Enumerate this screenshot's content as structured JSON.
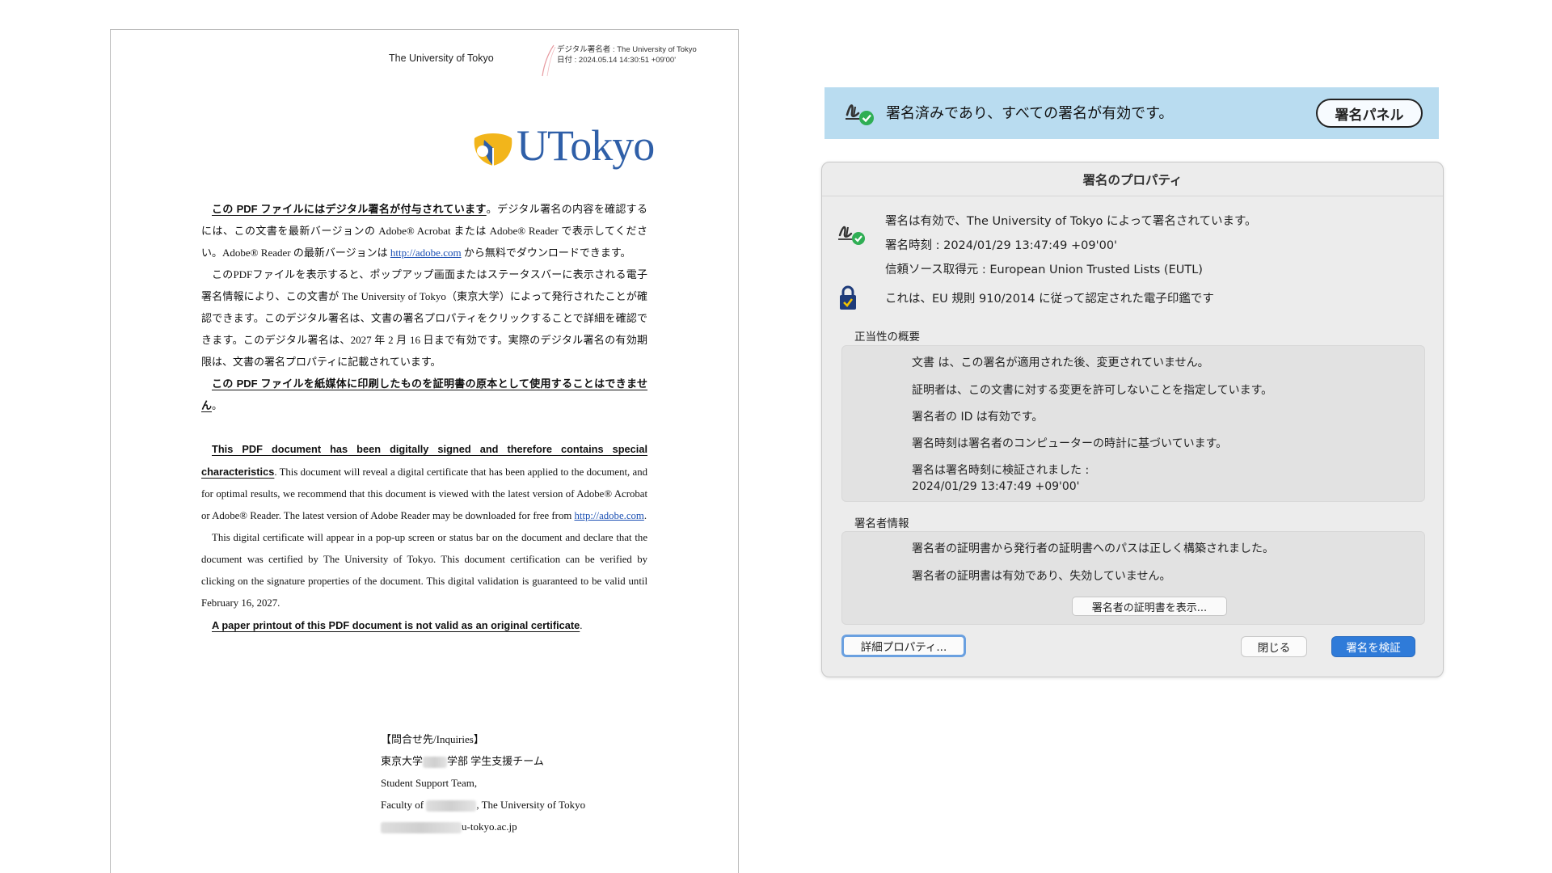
{
  "pdf": {
    "header_university": "The University of Tokyo",
    "stamp_line1": "デジタル署名者 : The University of Tokyo",
    "stamp_line2": "日付 : 2024.05.14 14:30:51 +09'00'",
    "logo_text": "UTokyo",
    "jp_p1_bold": "この PDF ファイルにはデジタル署名が付与されています",
    "jp_p1_rest_a": "。デジタル署名の内容を確認するには、この文書を最新バージョンの Adobe® Acrobat または Adobe® Reader で表示してください。Adobe® Reader の最新バージョンは ",
    "jp_p1_link": "http://adobe.com",
    "jp_p1_rest_b": " から無料でダウンロードできます。",
    "jp_p2": "このPDFファイルを表示すると、ポップアップ画面またはステータスバーに表示される電子署名情報により、この文書が The University of Tokyo（東京大学）によって発行されたことが確認できます。このデジタル署名は、文書の署名プロパティをクリックすることで詳細を確認できます。このデジタル署名は、2027 年 2 月 16 日まで有効です。実際のデジタル署名の有効期限は、文書の署名プロパティに記載されています。",
    "jp_p3_bold": "この PDF ファイルを紙媒体に印刷したものを証明書の原本として使用することはできません",
    "jp_p3_end": "。",
    "en_p1_bold": "This PDF document has been digitally signed and therefore contains special characteristics",
    "en_p1_rest_a": ". This document will reveal a digital certificate that has been applied to the document, and for optimal results, we recommend that this document is viewed with the latest version of Adobe® Acrobat or Adobe® Reader. The latest version of Adobe Reader may be downloaded for free from ",
    "en_p1_link": "http://adobe.com",
    "en_p1_rest_b": ".",
    "en_p2": "This digital certificate will appear in a pop-up screen or status bar on the document and declare that the document was certified by The University of Tokyo. This document certification can be verified by clicking on the signature properties of the document. This digital validation is guaranteed to be valid until February 16, 2027.",
    "en_p3_bold": "A paper printout of this PDF document is not valid as an original certificate",
    "en_p3_end": ".",
    "inquiry_title": "【問合せ先/Inquiries】",
    "inquiry_line1_a": "東京大学",
    "inquiry_line1_b": "学部 学生支援チーム",
    "inquiry_line2": "Student Support Team,",
    "inquiry_line3_a": "Faculty of",
    "inquiry_line3_b": ", The University of Tokyo",
    "inquiry_line4": "u-tokyo.ac.jp"
  },
  "banner": {
    "text": "署名済みであり、すべての署名が有効です。",
    "panel_button": "署名パネル",
    "bg_color": "#b9dcf0"
  },
  "dialog": {
    "title": "署名のプロパティ",
    "info_line1": "署名は有効で、The University of Tokyo によって署名されています。",
    "info_line2": "署名時刻 :  2024/01/29 13:47:49 +09'00'",
    "info_line3": "信頼ソース取得元 : European Union Trusted Lists (EUTL)",
    "eu_line": "これは、EU 規則 910/2014 に従って認定された電子印鑑です",
    "validity_label": "正当性の概要",
    "validity_items": [
      "文書 は、この署名が適用された後、変更されていません。",
      "証明者は、この文書に対する変更を許可しないことを指定しています。",
      "署名者の ID は有効です。",
      "署名時刻は署名者のコンピューターの時計に基づいています。",
      "署名は署名時刻に検証されました :",
      "2024/01/29 13:47:49 +09'00'"
    ],
    "signer_label": "署名者情報",
    "signer_items": [
      "署名者の証明書から発行者の証明書へのパスは正しく構築されました。",
      "署名者の証明書は有効であり、失効していません。"
    ],
    "show_cert_button": "署名者の証明書を表示...",
    "detail_button": "詳細プロパティ...",
    "close_button": "閉じる",
    "verify_button": "署名を検証",
    "accent_color": "#2f7bd9"
  }
}
